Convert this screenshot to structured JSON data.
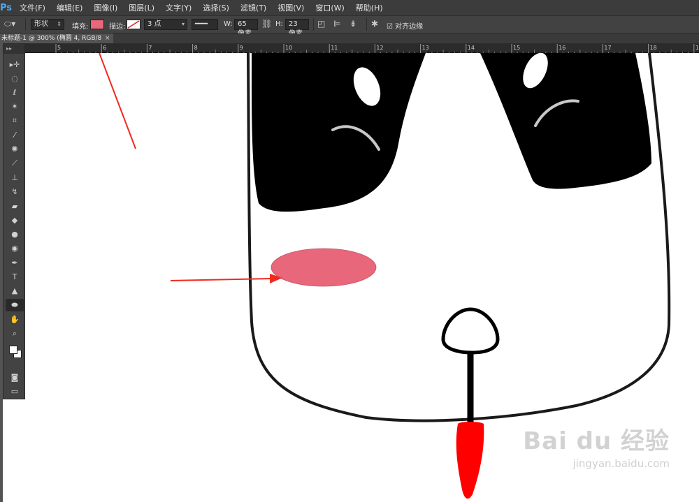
{
  "app": {
    "logo": "Ps"
  },
  "menu": [
    "文件(F)",
    "编辑(E)",
    "图像(I)",
    "图层(L)",
    "文字(Y)",
    "选择(S)",
    "滤镜(T)",
    "视图(V)",
    "窗口(W)",
    "帮助(H)"
  ],
  "options": {
    "tool_mode": "形状",
    "fill_label": "填充:",
    "fill_color": "#e8677a",
    "stroke_label": "描边:",
    "stroke_width": "3 点",
    "width_label": "W:",
    "width_value": "65 像素",
    "height_label": "H:",
    "height_value": "23 像素",
    "align_edges_label": "对齐边缘",
    "align_edges_checked": true
  },
  "document_tab": {
    "title": "未标题-1 @ 300% (椭圆 4, RGB/8",
    "close": "×"
  },
  "ruler_ticks": [
    "5",
    "6",
    "7",
    "8",
    "9",
    "10",
    "11",
    "12",
    "13",
    "14",
    "15",
    "16",
    "17",
    "18",
    "19"
  ],
  "artwork": {
    "cheek_color": "#e8677a",
    "tongue_color": "#ff0000",
    "outline_color": "#000000"
  },
  "tools": [
    {
      "name": "move-tool-icon",
      "glyph": "▸✛"
    },
    {
      "name": "marquee-tool-icon",
      "glyph": "◌"
    },
    {
      "name": "lasso-tool-icon",
      "glyph": "ℓ"
    },
    {
      "name": "magic-wand-tool-icon",
      "glyph": "✶"
    },
    {
      "name": "crop-tool-icon",
      "glyph": "⌗"
    },
    {
      "name": "eyedropper-tool-icon",
      "glyph": "⁄"
    },
    {
      "name": "healing-brush-tool-icon",
      "glyph": "✺"
    },
    {
      "name": "brush-tool-icon",
      "glyph": "⟋"
    },
    {
      "name": "clone-stamp-tool-icon",
      "glyph": "⊥"
    },
    {
      "name": "history-brush-tool-icon",
      "glyph": "↯"
    },
    {
      "name": "eraser-tool-icon",
      "glyph": "▰"
    },
    {
      "name": "paint-bucket-tool-icon",
      "glyph": "◆"
    },
    {
      "name": "blur-tool-icon",
      "glyph": "●"
    },
    {
      "name": "dodge-tool-icon",
      "glyph": "◉"
    },
    {
      "name": "pen-tool-icon",
      "glyph": "✒"
    },
    {
      "name": "type-tool-icon",
      "glyph": "T"
    },
    {
      "name": "path-selection-tool-icon",
      "glyph": "▲"
    },
    {
      "name": "ellipse-tool-icon",
      "glyph": "⬬"
    },
    {
      "name": "hand-tool-icon",
      "glyph": "✋"
    },
    {
      "name": "zoom-tool-icon",
      "glyph": "⌕"
    }
  ],
  "watermark": {
    "main": "Bai du 经验",
    "sub": "jingyan.baidu.com"
  }
}
